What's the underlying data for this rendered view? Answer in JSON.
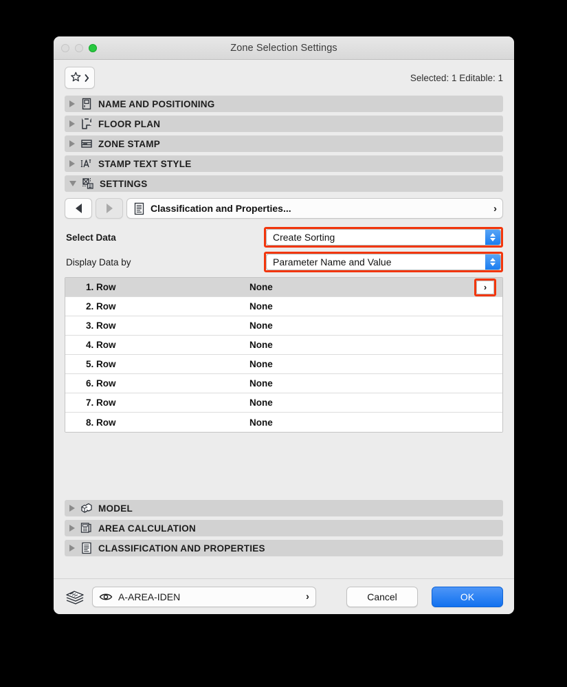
{
  "window": {
    "title": "Zone Selection Settings",
    "traffic_lights": [
      "close",
      "minimize",
      "zoom"
    ]
  },
  "topbar": {
    "favorites_icon": "star-icon",
    "selection_info": "Selected: 1 Editable: 1"
  },
  "sections": [
    {
      "label": "NAME AND POSITIONING",
      "icon": "door-plan-icon",
      "expanded": false
    },
    {
      "label": "FLOOR PLAN",
      "icon": "floor-plan-icon",
      "expanded": false
    },
    {
      "label": "ZONE STAMP",
      "icon": "zone-stamp-icon",
      "expanded": false
    },
    {
      "label": "STAMP TEXT STYLE",
      "icon": "text-style-icon",
      "expanded": false
    },
    {
      "label": "SETTINGS",
      "icon": "settings-grid-icon",
      "expanded": true
    }
  ],
  "sections_bottom": [
    {
      "label": "MODEL",
      "icon": "model-cubes-icon",
      "expanded": false
    },
    {
      "label": "AREA CALCULATION",
      "icon": "calculator-icon",
      "expanded": false
    },
    {
      "label": "CLASSIFICATION AND PROPERTIES",
      "icon": "document-list-icon",
      "expanded": false
    }
  ],
  "settings_panel": {
    "nav": {
      "back_icon": "arrow-left-icon",
      "forward_icon": "arrow-right-icon",
      "field_icon": "document-list-icon",
      "field_label": "Classification and Properties...",
      "disclosure_icon": "chevron-right-icon"
    },
    "fields": [
      {
        "label": "Select Data",
        "bold": true,
        "value": "Create Sorting",
        "highlighted": true,
        "stepper_color": "#1a7df0"
      },
      {
        "label": "Display Data by",
        "bold": false,
        "value": "Parameter Name and Value",
        "highlighted": true,
        "stepper_color": "#1a7df0"
      }
    ],
    "rows": [
      {
        "name": "1. Row",
        "value": "None",
        "selected": true,
        "has_chevron": true,
        "chevron_highlighted": true
      },
      {
        "name": "2. Row",
        "value": "None",
        "selected": false,
        "has_chevron": false,
        "chevron_highlighted": false
      },
      {
        "name": "3. Row",
        "value": "None",
        "selected": false,
        "has_chevron": false,
        "chevron_highlighted": false
      },
      {
        "name": "4. Row",
        "value": "None",
        "selected": false,
        "has_chevron": false,
        "chevron_highlighted": false
      },
      {
        "name": "5. Row",
        "value": "None",
        "selected": false,
        "has_chevron": false,
        "chevron_highlighted": false
      },
      {
        "name": "6. Row",
        "value": "None",
        "selected": false,
        "has_chevron": false,
        "chevron_highlighted": false
      },
      {
        "name": "7. Row",
        "value": "None",
        "selected": false,
        "has_chevron": false,
        "chevron_highlighted": false
      },
      {
        "name": "8. Row",
        "value": "None",
        "selected": false,
        "has_chevron": false,
        "chevron_highlighted": false
      }
    ]
  },
  "footer": {
    "layers_icon": "layers-icon",
    "visibility_icon": "eye-icon",
    "layer_name": "A-AREA-IDEN",
    "layer_disclosure_icon": "chevron-right-icon",
    "cancel_label": "Cancel",
    "ok_label": "OK"
  },
  "colors": {
    "highlight": "#f2360c",
    "accent_blue": "#1271ef",
    "window_bg": "#ececec",
    "band_bg": "#d2d2d2",
    "selected_row": "#d6d6d6"
  }
}
